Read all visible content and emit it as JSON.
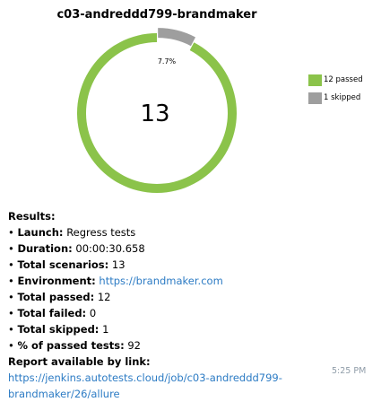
{
  "chart_data": {
    "type": "pie",
    "title": "c03-andreddd799-brandmaker",
    "categories": [
      "passed",
      "skipped"
    ],
    "values": [
      12,
      1
    ],
    "center_label": "13",
    "slice_label": "7.7%",
    "legend": [
      "12 passed",
      "1 skipped"
    ],
    "legend_position": "right",
    "colors": [
      "#8bc34a",
      "#9e9e9e"
    ]
  },
  "results": {
    "heading": "Results:",
    "bullet": "•",
    "launch_label": "Launch:",
    "launch_value": "Regress tests",
    "duration_label": "Duration:",
    "duration_value": "00:00:30.658",
    "total_scenarios_label": "Total scenarios:",
    "total_scenarios_value": "13",
    "environment_label": "Environment:",
    "environment_value": "https://brandmaker.com",
    "total_passed_label": "Total passed:",
    "total_passed_value": "12",
    "total_failed_label": "Total failed:",
    "total_failed_value": "0",
    "total_skipped_label": "Total skipped:",
    "total_skipped_value": "1",
    "percent_passed_label": "% of passed tests:",
    "percent_passed_value": "92",
    "report_label": "Report available by link:",
    "report_link": "https://jenkins.autotests.cloud/job/c03-andreddd799-brandmaker/26/allure"
  },
  "timestamp": "5:25 PM",
  "link_color": "#2c7bc4"
}
